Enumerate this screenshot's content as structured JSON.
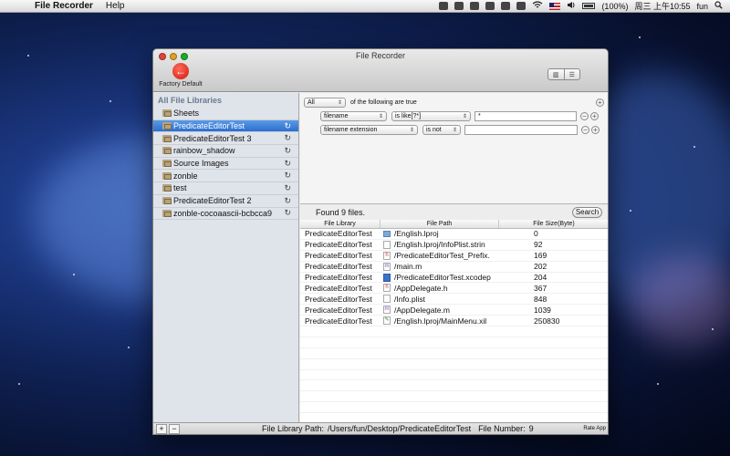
{
  "menubar": {
    "apple": "",
    "app_name": "File Recorder",
    "menus": [
      "Help"
    ],
    "battery": "(100%)",
    "clock": "周三 上午10:55",
    "user": "fun"
  },
  "window": {
    "title": "File Recorder",
    "factory_label": "Factory Default"
  },
  "sidebar": {
    "header": "All File Libraries",
    "items": [
      {
        "label": "Sheets",
        "refresh": false
      },
      {
        "label": "PredicateEditorTest",
        "refresh": true,
        "selected": true
      },
      {
        "label": "PredicateEditorTest 3",
        "refresh": true
      },
      {
        "label": "rainbow_shadow",
        "refresh": true
      },
      {
        "label": "Source Images",
        "refresh": true
      },
      {
        "label": "zonble",
        "refresh": true
      },
      {
        "label": "test",
        "refresh": true
      },
      {
        "label": "PredicateEditorTest 2",
        "refresh": true
      },
      {
        "label": "zonble-cocoaascii-bcbcca9",
        "refresh": true
      }
    ]
  },
  "predicate": {
    "scope": "All",
    "scope_suffix": "of the following are true",
    "rows": [
      {
        "field": "filename",
        "operator": "is like[?*]",
        "value": "*"
      },
      {
        "field": "filename extension",
        "operator": "is not",
        "value": ""
      }
    ]
  },
  "search": {
    "found_text": "Found 9 files.",
    "button": "Search"
  },
  "table": {
    "columns": [
      "File Library",
      "File Path",
      "File Size(Byte)"
    ],
    "rows": [
      {
        "library": "PredicateEditorTest",
        "path": "/English.lproj",
        "size": "0",
        "icon": "folder"
      },
      {
        "library": "PredicateEditorTest",
        "path": "/English.lproj/InfoPlist.strin",
        "size": "92",
        "icon": "doc"
      },
      {
        "library": "PredicateEditorTest",
        "path": "/PredicateEditorTest_Prefix.",
        "size": "169",
        "icon": "h"
      },
      {
        "library": "PredicateEditorTest",
        "path": "/main.m",
        "size": "202",
        "icon": "m"
      },
      {
        "library": "PredicateEditorTest",
        "path": "/PredicateEditorTest.xcodep",
        "size": "204",
        "icon": "xcode"
      },
      {
        "library": "PredicateEditorTest",
        "path": "/AppDelegate.h",
        "size": "367",
        "icon": "h"
      },
      {
        "library": "PredicateEditorTest",
        "path": "/Info.plist",
        "size": "848",
        "icon": "doc"
      },
      {
        "library": "PredicateEditorTest",
        "path": "/AppDelegate.m",
        "size": "1039",
        "icon": "m"
      },
      {
        "library": "PredicateEditorTest",
        "path": "/English.lproj/MainMenu.xil",
        "size": "250830",
        "icon": "xib"
      }
    ]
  },
  "bottombar": {
    "add": "+",
    "remove": "−",
    "path_label": "File Library Path:",
    "path_value": "/Users/fun/Desktop/PredicateEditorTest",
    "number_label": "File Number:",
    "number_value": "9",
    "rate": "Rate App"
  }
}
